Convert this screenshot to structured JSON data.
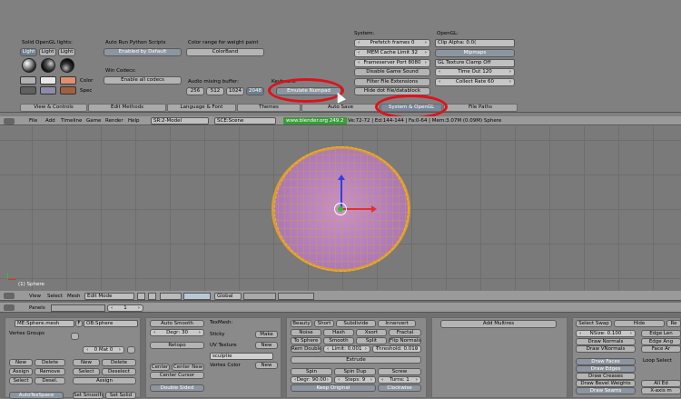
{
  "prefs": {
    "solid_opengl_lights": "Solid OpenGL lights:",
    "light_buttons": [
      "Light",
      "Light",
      "Light"
    ],
    "color_label": "Color",
    "spec_label": "Spec",
    "auto_run_label": "Auto Run Python Scripts",
    "auto_run_button": "Enabled by Default",
    "win_codecs_label": "Win Codecs:",
    "win_codecs_button": "Enable all codecs",
    "color_range_label": "Color range for weight paint",
    "colorband_button": "ColorBand",
    "audio_label": "Audio mixing buffer:",
    "audio_options": [
      "256",
      "512",
      "1024",
      "2048"
    ],
    "keyboard_label": "Keyboard:",
    "emulate_numpad": "Emulate Numpad",
    "system_label": "System:",
    "prefetch": "Prefetch frames 0",
    "mem_cache": "MEM Cache Limit 32",
    "frameserver": "Frameserver Port 8080",
    "disable_sound": "Disable Game Sound",
    "filter_ext": "Filter File Extensions",
    "hide_dot": "Hide dot file/datablock",
    "opengl_label": "OpenGL:",
    "clip_alpha": "Clip Alpha: 0.0(",
    "mipmaps": "Mipmaps",
    "gl_texture_clamp": "GL Texture Clamp Off",
    "time_out": "Time Out 120",
    "collect_rate": "Collect Rate 60",
    "colors": {
      "swatch1": "#b0b0b0",
      "swatch2": "#e8e8e8",
      "swatch3": "#e09070",
      "swatch4": "#606060",
      "swatch5": "#8c8ca8",
      "swatch6": "#a06040"
    }
  },
  "tabs": [
    "View & Controls",
    "Edit Methods",
    "Language & Font",
    "Themes",
    "Auto Save",
    "System & OpenGL",
    "File Paths"
  ],
  "info_header": {
    "menus": [
      "File",
      "Add",
      "Timeline",
      "Game",
      "Render",
      "Help"
    ],
    "screen": "SR:2-Model",
    "scene": "SCE:Scene",
    "url": "www.blender.org 249.2",
    "stats": "Ve:72-72 | Ed:144-144 | Fa:0-64 | Mem:3.07M (0.09M) Sphere"
  },
  "viewport": {
    "object_label": "(1) Sphere"
  },
  "view_header": {
    "menus": [
      "View",
      "Select",
      "Mesh"
    ],
    "mode": "Edit Mode",
    "orientation": "Global"
  },
  "buttons_header": {
    "menus": [
      "Panels"
    ],
    "frame": "1"
  },
  "link_panel": {
    "me_name": "ME:Sphere.mesh",
    "f_label": "F",
    "ob_name": "OB:Sphere",
    "vertex_groups": "Vertex Groups",
    "mat": "0 Mat 0",
    "new": "New",
    "delete": "Delete",
    "assign": "Assign",
    "remove": "Remove",
    "select": "Select",
    "deselect": "Desel.",
    "new2": "New",
    "delete2": "Delete",
    "select2": "Select",
    "deselect2": "Deselect",
    "assign2": "Assign",
    "autotexspace": "AutoTexSpace",
    "set_smooth": "Set Smooth",
    "set_solid": "Set Solid"
  },
  "mesh_panel": {
    "auto_smooth": "Auto Smooth",
    "degr": "Degr: 30",
    "retopo": "Retopo",
    "center": "Center",
    "center_new": "Center New",
    "center_cursor": "Center Cursor",
    "double_sided": "Double Sided",
    "texmesh": "TexMesh:",
    "sticky": "Sticky",
    "make": "Make",
    "uv_texture": "UV Texture",
    "new": "New",
    "uv_name": "sculptie",
    "vertex_color": "Vertex Color",
    "new2": "New"
  },
  "tools_panel": {
    "tabs": [
      "Beauty",
      "Short",
      "Subdivide",
      "Innervert"
    ],
    "noise": "Noise",
    "hash": "Hash",
    "xsort": "Xsort",
    "fractal": "Fractal",
    "to_sphere": "To Sphere",
    "smooth": "Smooth",
    "split": "Split",
    "flip_normals": "Flip Normals",
    "rem_double": "Rem Double",
    "limit": "Limit: 0.001",
    "threshold": "Threshold: 0.010",
    "extrude": "Extrude",
    "spin": "Spin",
    "spin_dup": "Spin Dup",
    "screw": "Screw",
    "degr": "Degr: 90.00",
    "steps": "Steps: 9",
    "turns": "Turns: 1",
    "keep_original": "Keep Original",
    "clockwise": "Clockwise"
  },
  "multires": {
    "add_multires": "Add Multires"
  },
  "mesh_tools_more": {
    "select_swap": "Select Swap",
    "hide": "Hide",
    "reveal": "Re",
    "nsize": "NSize: 0.100",
    "draw_normals": "Draw Normals",
    "draw_vnormals": "Draw VNormals",
    "edge_len": "Edge Len",
    "edge_ang": "Edge Ang",
    "face_ar": "Face Ar",
    "draw_faces": "Draw Faces",
    "draw_edges": "Draw Edges",
    "draw_creases": "Draw Creases",
    "draw_bevel": "Draw Bevel Weights",
    "draw_seams": "Draw Seams",
    "loop_select": "Loop Select",
    "all_edges": "All Ed",
    "x_axis": "X-axis m"
  }
}
